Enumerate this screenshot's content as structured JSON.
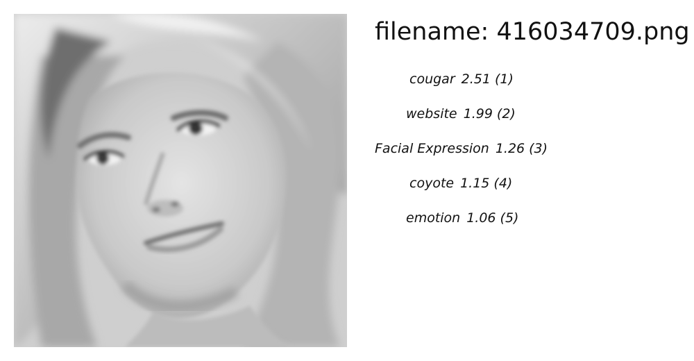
{
  "filename_text": "filename: 416034709.png",
  "labels": [
    {
      "name": "cougar",
      "score": "2.51",
      "rank": "(1)"
    },
    {
      "name": "website",
      "score": "1.99",
      "rank": "(2)"
    },
    {
      "name": "Facial Expression",
      "score": "1.26",
      "rank": "(3)"
    },
    {
      "name": "coyote",
      "score": "1.15",
      "rank": "(4)"
    },
    {
      "name": "emotion",
      "score": "1.06",
      "rank": "(5)"
    }
  ]
}
